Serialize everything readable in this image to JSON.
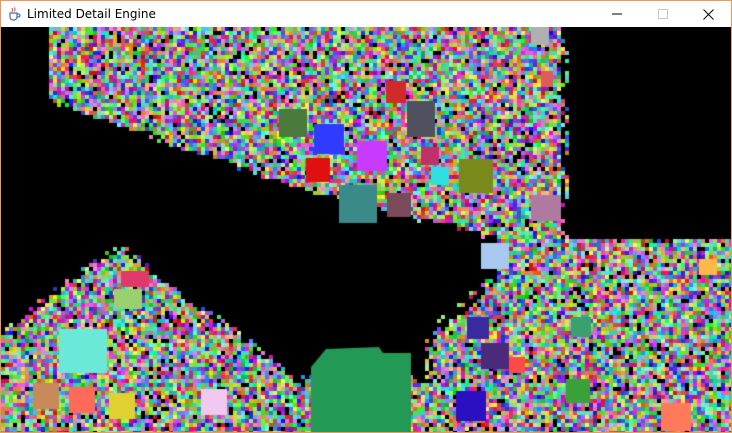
{
  "window": {
    "title": "Limited Detail Engine",
    "app_icon": "java-coffee-cup-icon",
    "border_color": "#e89a5a",
    "controls": {
      "minimize_icon": "minimize-icon",
      "maximize_icon": "maximize-icon",
      "close_icon": "close-icon"
    }
  },
  "scene": {
    "background": "#000000",
    "description_icon": "voxel-render-canvas",
    "palette": [
      "#ff4fa0",
      "#33e0e0",
      "#7cff5a",
      "#ffd23a",
      "#5a6bff",
      "#ff7a3a",
      "#b45aff",
      "#3aa06b",
      "#ffffff",
      "#7a7a7a",
      "#ff3a3a",
      "#3affb4",
      "#a0ff3a",
      "#3a7aff",
      "#ff9ad0",
      "#c8c850",
      "#50c8c8",
      "#8a4a2a",
      "#2a8a4a",
      "#e0a0ff"
    ]
  }
}
